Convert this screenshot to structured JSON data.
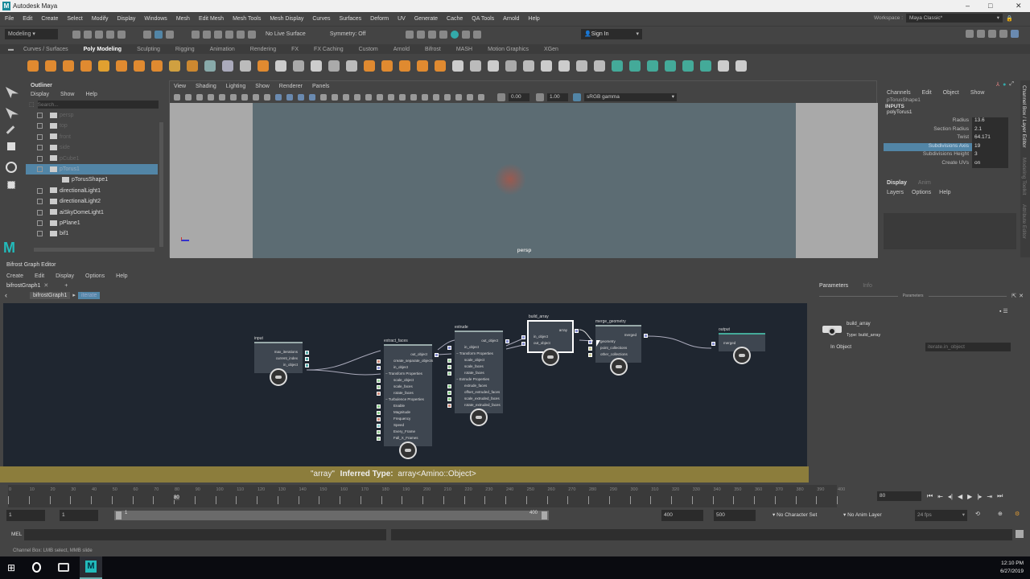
{
  "app": {
    "title": "Autodesk Maya",
    "logo": "M"
  },
  "menubar": [
    "File",
    "Edit",
    "Create",
    "Select",
    "Modify",
    "Display",
    "Windows",
    "Mesh",
    "Edit Mesh",
    "Mesh Tools",
    "Mesh Display",
    "Curves",
    "Surfaces",
    "Deform",
    "UV",
    "Generate",
    "Cache",
    "QA Tools",
    "Arnold",
    "Help"
  ],
  "status": {
    "mode": "Modeling",
    "live_surface": "No Live Surface",
    "symmetry": "Symmetry: Off",
    "sign_in": "Sign In",
    "workspace_label": "Workspace :",
    "workspace": "Maya Classic*"
  },
  "shelf_tabs": [
    "Curves / Surfaces",
    "Poly Modeling",
    "Sculpting",
    "Rigging",
    "Animation",
    "Rendering",
    "FX",
    "FX Caching",
    "Custom",
    "Arnold",
    "Bifrost",
    "MASH",
    "Motion Graphics",
    "XGen"
  ],
  "shelf_active": "Poly Modeling",
  "outliner": {
    "title": "Outliner",
    "menus": [
      "Display",
      "Show",
      "Help"
    ],
    "search_placeholder": "Search...",
    "items": [
      {
        "label": "persp",
        "dim": true
      },
      {
        "label": "top",
        "dim": true
      },
      {
        "label": "front",
        "dim": true
      },
      {
        "label": "side",
        "dim": true
      },
      {
        "label": "pCube1",
        "dim": true
      },
      {
        "label": "pTorus1",
        "selected": true
      },
      {
        "label": "pTorusShape1",
        "child": true
      },
      {
        "label": "directionalLight1"
      },
      {
        "label": "directionalLight2"
      },
      {
        "label": "aiSkyDomeLight1"
      },
      {
        "label": "pPlane1"
      },
      {
        "label": "bif1"
      }
    ]
  },
  "viewport": {
    "menus": [
      "View",
      "Shading",
      "Lighting",
      "Show",
      "Renderer",
      "Panels"
    ],
    "exposure": "0.00",
    "gamma": "1.00",
    "colorspace": "sRGB gamma",
    "camera": "persp"
  },
  "channelbox": {
    "menus": [
      "Channels",
      "Edit",
      "Object",
      "Show"
    ],
    "shape": "pTorusShape1",
    "inputs": "INPUTS",
    "node": "polyTorus1",
    "attrs": [
      {
        "name": "Radius",
        "value": "13.6"
      },
      {
        "name": "Section Radius",
        "value": "2.1"
      },
      {
        "name": "Twist",
        "value": "64.171"
      },
      {
        "name": "Subdivisions Axis",
        "value": "19",
        "selected": true
      },
      {
        "name": "Subdivisions Height",
        "value": "3"
      },
      {
        "name": "Create UVs",
        "value": "on"
      }
    ],
    "layer_tabs": [
      "Display",
      "Anim"
    ],
    "layer_menus": [
      "Layers",
      "Options",
      "Help"
    ]
  },
  "side_tabs": [
    "Channel Box / Layer Editor",
    "Modeling Toolkit",
    "Attribute Editor"
  ],
  "bifrost": {
    "title": "Bifrost Graph Editor",
    "menus": [
      "Create",
      "Edit",
      "Display",
      "Options",
      "Help"
    ],
    "tab": "bifrostGraph1",
    "breadcrumb": [
      "bifrostGraph1",
      "iterate"
    ],
    "tooltip_name": "\"array\"",
    "tooltip_label": "Inferred Type:",
    "tooltip_type": "array<Amino::Object>",
    "nodes": {
      "input": {
        "title": "input",
        "outputs": [
          "max_iterations",
          "current_index",
          "in_object"
        ],
        "inputs": []
      },
      "extract_faces": {
        "title": "extract_faces",
        "outputs": [
          "out_object"
        ],
        "inputs": [
          "create_separate_objects",
          "in_object",
          "− Transform Properties",
          "scale_object",
          "scale_faces",
          "rotate_faces",
          "− Turbulence Properties",
          "Enable",
          "Magnitude",
          "Frequency",
          "Speed",
          "Every_Frame",
          "Fall_X_Frames"
        ]
      },
      "extrude": {
        "title": "extrude",
        "outputs": [
          "out_object"
        ],
        "inputs": [
          "in_object",
          "− Transform Properties",
          "scale_object",
          "scale_faces",
          "rotate_faces",
          "− Extrude Properties",
          "extrude_faces",
          "offset_extruded_faces",
          "scale_extruded_faces",
          "rotate_extruded_faces"
        ]
      },
      "build_array": {
        "title": "build_array",
        "outputs": [
          "array"
        ],
        "inputs": [
          "in_object",
          "out_object"
        ]
      },
      "merge_geometry": {
        "title": "merge_geometry",
        "outputs": [
          "merged"
        ],
        "inputs": [
          "geometry",
          "point_collections",
          "other_collections"
        ]
      },
      "output": {
        "title": "output",
        "outputs": [],
        "inputs": [
          "merged"
        ]
      }
    }
  },
  "parameters": {
    "tabs": [
      "Parameters",
      "Info"
    ],
    "section": "Parameters",
    "node_name": "build_array",
    "node_type": "Type: build_array",
    "field_label": "In Object",
    "field_value": "iterate.in_object"
  },
  "timeline": {
    "start": 0,
    "end": 400,
    "step": 10,
    "current": "80",
    "current_frame_field": "80"
  },
  "range": {
    "start": "1",
    "anim_start": "1",
    "slider_start": "1",
    "slider_end": "400",
    "end": "400",
    "anim_end": "500",
    "character_set": "No Character Set",
    "anim_layer": "No Anim Layer",
    "fps": "24 fps"
  },
  "mel": {
    "label": "MEL"
  },
  "help_line": "Channel Box: LMB select, MMB slide",
  "taskbar": {
    "time": "12:10 PM",
    "date": "6/27/2019"
  }
}
